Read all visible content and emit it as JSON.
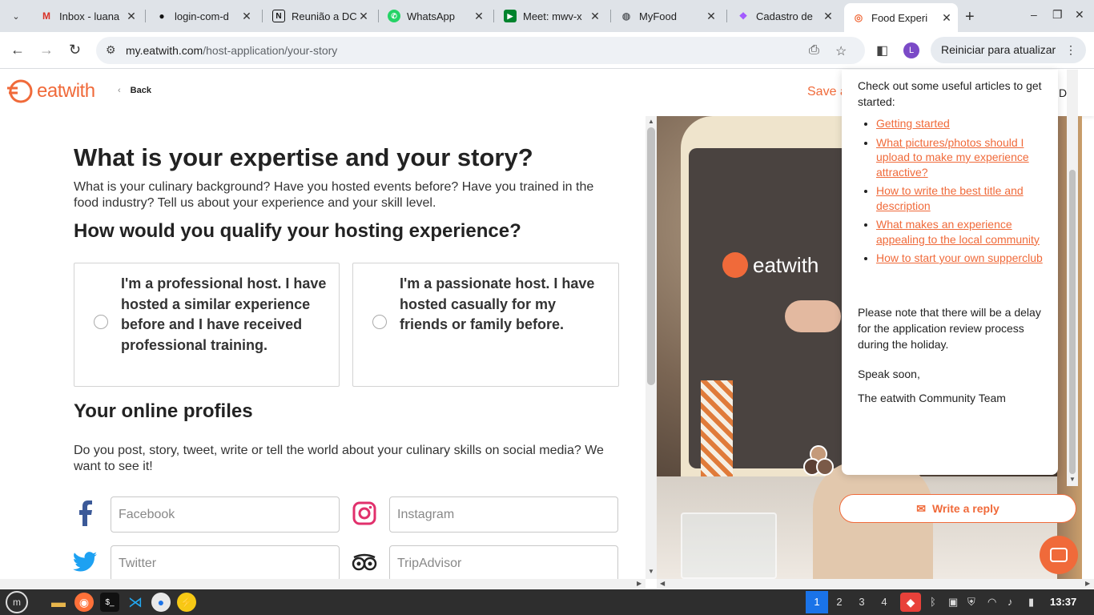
{
  "browser": {
    "tabs": [
      {
        "label": "Inbox - luana",
        "icon": "gmail-icon"
      },
      {
        "label": "login-com-d",
        "icon": "github-icon"
      },
      {
        "label": "Reunião a DC",
        "icon": "notion-icon"
      },
      {
        "label": "WhatsApp",
        "icon": "whatsapp-icon"
      },
      {
        "label": "Meet: mwv-x",
        "icon": "meet-icon"
      },
      {
        "label": "MyFood",
        "icon": "globe-icon"
      },
      {
        "label": "Cadastro de",
        "icon": "figma-icon"
      },
      {
        "label": "Food Experi",
        "icon": "eatwith-icon"
      }
    ],
    "url_domain": "my.eatwith.com",
    "url_path": "/host-application/your-story",
    "profile_initial": "L",
    "update_label": "Reiniciar para atualizar"
  },
  "header": {
    "logo_text": "eatwith",
    "back_label": "Back",
    "save_label": "Save a",
    "d_label": "D"
  },
  "main": {
    "title": "What is your expertise and your story?",
    "intro": "What is your culinary background? Have you hosted events before? Have you trained in the food industry? Tell us about your experience and your skill level.",
    "qualify_heading": "How would you qualify your hosting experience?",
    "options": [
      {
        "label": "I'm a professional host. I have hosted a similar experience before and I have received professional training."
      },
      {
        "label": "I'm a passionate host. I have hosted casually for my friends or family before."
      }
    ],
    "profiles_heading": "Your online profiles",
    "profiles_intro": "Do you post, story, tweet, write or tell the world about your culinary skills on social media? We want to see it!",
    "social_fields": [
      {
        "placeholder": "Facebook"
      },
      {
        "placeholder": "Instagram"
      },
      {
        "placeholder": "Twitter"
      },
      {
        "placeholder": "TripAdvisor"
      }
    ]
  },
  "photo": {
    "apron_text": "eatwith"
  },
  "chat": {
    "intro": "Check out some useful articles to get started:",
    "articles": [
      "Getting started",
      "What pictures/photos should I upload to make my experience attractive?",
      "How to write the best title and description",
      "What makes an experience appealing to the local community",
      "How to start your own supperclub"
    ],
    "note": "Please note that there will be a delay for the application review process during the holiday.",
    "sign_off": "Speak soon,",
    "team": "The eatwith Community Team",
    "reply_label": "Write a reply"
  },
  "taskbar": {
    "workspaces": [
      "1",
      "2",
      "3",
      "4"
    ],
    "clock": "13:37"
  },
  "colors": {
    "brand": "#f06a3a",
    "accent_blue": "#1a73e8"
  }
}
